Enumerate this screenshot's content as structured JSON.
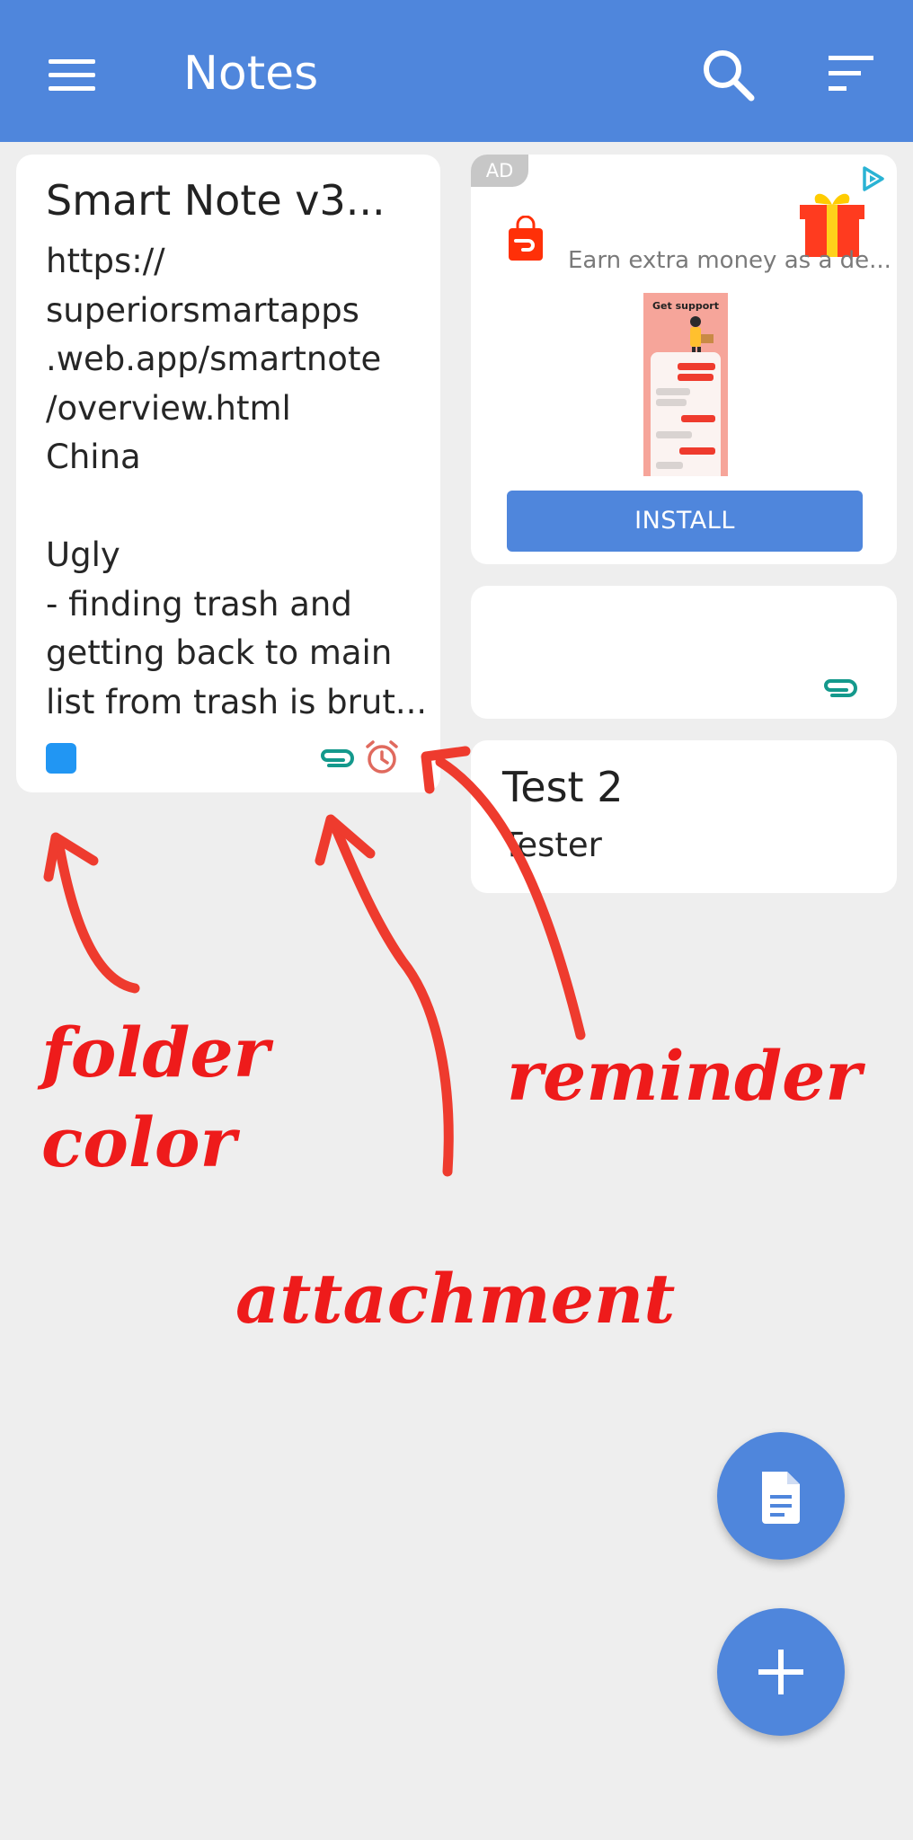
{
  "app_bar": {
    "title": "Notes",
    "icons": [
      "menu-icon",
      "search-icon",
      "sort-icon"
    ]
  },
  "notes": [
    {
      "title": "Smart Note v3...",
      "body_lines": [
        "https://",
        "superiorsmartapps",
        ".web.app/smartnote",
        "/overview.html",
        "China",
        "",
        "Ugly",
        "- finding trash and",
        "getting back to main",
        "list from trash is brut..."
      ],
      "folder_color": "#2196f3",
      "has_attachment": true,
      "has_reminder": true
    },
    {
      "title": "",
      "has_attachment": true
    },
    {
      "title": "Test 2",
      "body": "Tester"
    }
  ],
  "ad": {
    "badge": "AD",
    "text": "Earn extra money as a de...",
    "image_caption": "Get support",
    "button_label": "INSTALL"
  },
  "annotations": {
    "folder_line1": "folder",
    "folder_line2": "color",
    "reminder": "reminder",
    "attachment": "attachment"
  },
  "colors": {
    "app_bar": "#4f86dc",
    "background": "#eeeeee",
    "attachment_icon": "#14998c",
    "reminder_icon": "#e06a5e",
    "annotation": "#ee1b1b"
  }
}
